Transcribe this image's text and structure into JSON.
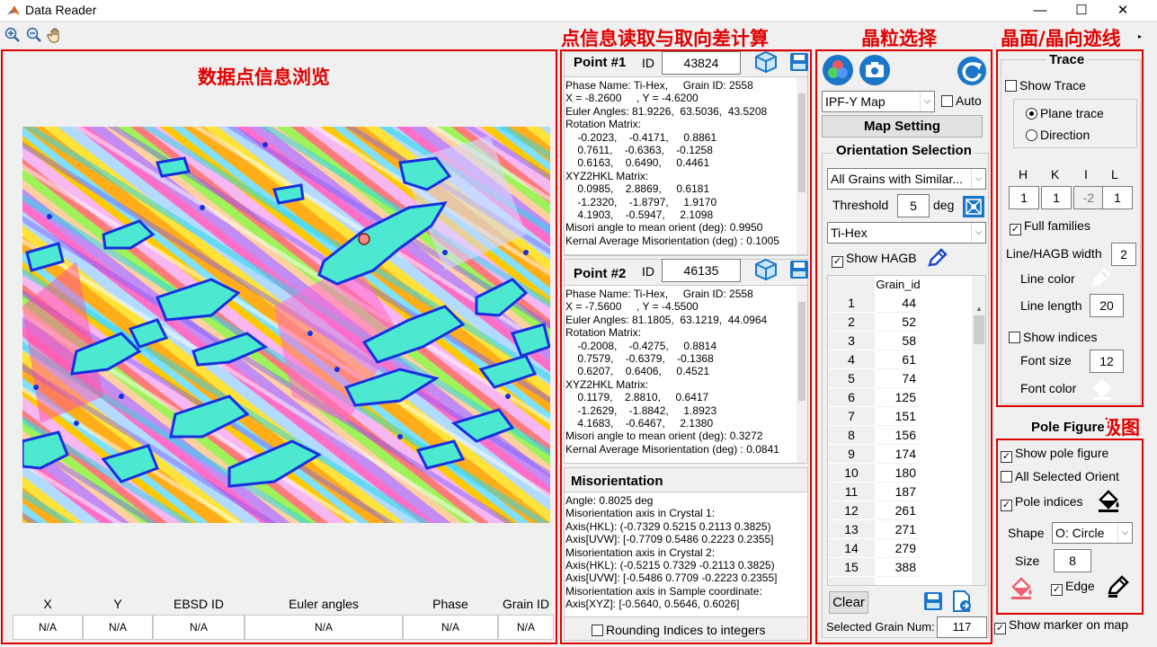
{
  "window": {
    "title": "Data Reader",
    "minimize": "—",
    "maximize": "☐",
    "close": "✕"
  },
  "labels": {
    "browse": "数据点信息浏览",
    "point_info": "点信息读取与取向差计算",
    "grain_sel": "晶粒选择",
    "trace": "晶面/晶向迹线",
    "pole": "极图"
  },
  "point1": {
    "title": "Point #1",
    "id_label": "ID",
    "id_value": "43824",
    "text": "Phase Name: Ti-Hex,     Grain ID: 2558\nX = -8.2600     , Y = -4.6200\nEuler Angles: 81.9226,  63.5036,  43.5208\nRotation Matrix:\n    -0.2023,    -0.4171,     0.8861\n    0.7611,    -0.6363,    -0.1258\n    0.6163,    0.6490,     0.4461\nXYZ2HKL Matrix:\n    0.0985,    2.8869,     0.6181\n    -1.2320,    -1.8797,     1.9170\n    4.1903,    -0.5947,     2.1098\nMisori angle to mean orient (deg): 0.9950\nKernal Average Misorientation (deg) : 0.1005"
  },
  "point2": {
    "title": "Point #2",
    "id_label": "ID",
    "id_value": "46135",
    "text": "Phase Name: Ti-Hex,     Grain ID: 2558\nX = -7.5600     , Y = -4.5500\nEuler Angles: 81.1805,  63.1219,  44.0964\nRotation Matrix:\n    -0.2008,    -0.4275,     0.8814\n    0.7579,    -0.6379,    -0.1368\n    0.6207,    0.6406,     0.4521\nXYZ2HKL Matrix:\n    0.1179,    2.8810,     0.6417\n    -1.2629,    -1.8842,     1.8923\n    4.1683,    -0.6467,     2.1380\nMisori angle to mean orient (deg): 0.3272\nKernal Average Misorientation (deg) : 0.0841"
  },
  "misorientation": {
    "title": "Misorientation",
    "text": "Angle: 0.8025 deg\nMisorientation axis in Crystal 1:\nAxis(HKL): (-0.7329 0.5215 0.2113 0.3825)\nAxis[UVW]: [-0.7709 0.5486 0.2223 0.2355]\nMisorientation axis in Crystal 2:\nAxis(HKL): (-0.5215 0.7329 -0.2113 0.3825)\nAxis[UVW]: [-0.5486 0.7709 -0.2223 0.2355]\nMisorientation axis in Sample coordinate:\nAxis[XYZ]: [-0.5640, 0.5646, 0.6026]",
    "rounding": "Rounding Indices to integers"
  },
  "table": {
    "headers": [
      "X",
      "Y",
      "EBSD ID",
      "Euler angles",
      "Phase",
      "Grain ID"
    ],
    "values": [
      "N/A",
      "N/A",
      "N/A",
      "N/A",
      "N/A",
      "N/A"
    ]
  },
  "grain": {
    "map_select": "IPF-Y Map",
    "auto": "Auto",
    "map_setting": "Map Setting",
    "orient_title": "Orientation Selection",
    "mode_select": "All Grains with Similar...",
    "threshold_label": "Threshold",
    "threshold_value": "5",
    "deg": "deg",
    "phase_select": "Ti-Hex",
    "show_hagb": "Show HAGB",
    "col_header": "Grain_id",
    "rows": [
      {
        "n": "1",
        "v": "44"
      },
      {
        "n": "2",
        "v": "52"
      },
      {
        "n": "3",
        "v": "58"
      },
      {
        "n": "4",
        "v": "61"
      },
      {
        "n": "5",
        "v": "74"
      },
      {
        "n": "6",
        "v": "125"
      },
      {
        "n": "7",
        "v": "151"
      },
      {
        "n": "8",
        "v": "156"
      },
      {
        "n": "9",
        "v": "174"
      },
      {
        "n": "10",
        "v": "180"
      },
      {
        "n": "11",
        "v": "187"
      },
      {
        "n": "12",
        "v": "261"
      },
      {
        "n": "13",
        "v": "271"
      },
      {
        "n": "14",
        "v": "279"
      },
      {
        "n": "15",
        "v": "388"
      }
    ],
    "clear": "Clear",
    "selected_label": "Selected Grain Num:",
    "selected_value": "117"
  },
  "trace": {
    "title": "Trace",
    "show_trace": "Show Trace",
    "plane": "Plane trace",
    "direction": "Direction",
    "h": "H",
    "k": "K",
    "i": "I",
    "l": "L",
    "hv": "1",
    "kv": "1",
    "iv": "-2",
    "lv": "1",
    "full_families": "Full families",
    "width_label": "Line/HAGB width",
    "width_value": "2",
    "color_label": "Line color",
    "length_label": "Line length",
    "length_value": "20",
    "show_indices": "Show indices",
    "font_size_label": "Font size",
    "font_size_value": "12",
    "font_color_label": "Font color"
  },
  "pole": {
    "title": "Pole Figure",
    "show_pf": "Show pole figure",
    "all_sel": "All Selected Orient",
    "pole_indices": "Pole indices",
    "shape_label": "Shape",
    "shape_value": "O: Circle",
    "size_label": "Size",
    "size_value": "8",
    "edge": "Edge",
    "show_marker": "Show marker on map"
  }
}
